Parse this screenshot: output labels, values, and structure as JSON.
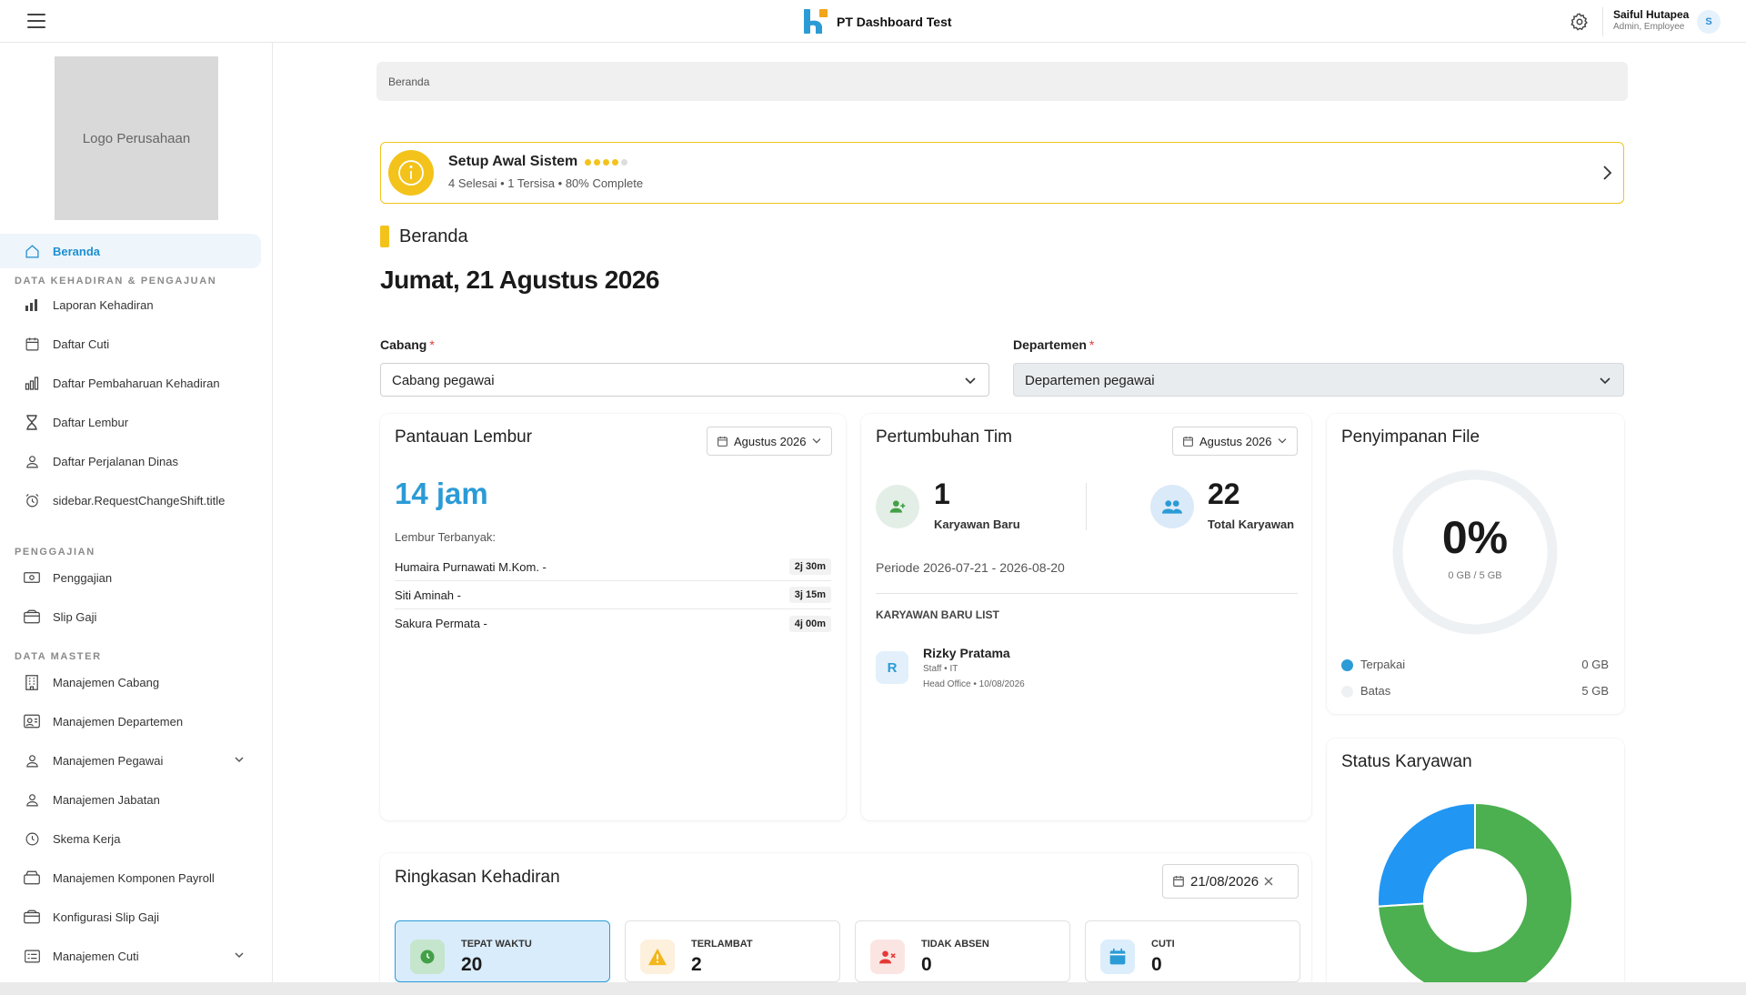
{
  "header": {
    "brand_title": "PT Dashboard Test",
    "user_name": "Saiful Hutapea",
    "user_role": "Admin, Employee",
    "avatar_initial": "S"
  },
  "sidebar": {
    "logo_text": "Logo Perusahaan",
    "home_label": "Beranda",
    "sections": [
      {
        "title": "DATA KEHADIRAN & PENGAJUAN",
        "items": [
          {
            "label": "Laporan Kehadiran",
            "icon": "bar-chart-icon"
          },
          {
            "label": "Daftar Cuti",
            "icon": "calendar-icon"
          },
          {
            "label": "Daftar Pembaharuan Kehadiran",
            "icon": "chart-icon"
          },
          {
            "label": "Daftar Lembur",
            "icon": "hourglass-icon"
          },
          {
            "label": "Daftar Perjalanan Dinas",
            "icon": "person-icon"
          },
          {
            "label": "sidebar.RequestChangeShift.title",
            "icon": "alarm-icon"
          }
        ]
      },
      {
        "title": "PENGGAJIAN",
        "items": [
          {
            "label": "Penggajian",
            "icon": "money-icon"
          },
          {
            "label": "Slip Gaji",
            "icon": "wallet-icon"
          }
        ]
      },
      {
        "title": "DATA MASTER",
        "items": [
          {
            "label": "Manajemen Cabang",
            "icon": "building-icon"
          },
          {
            "label": "Manajemen Departemen",
            "icon": "id-card-icon"
          },
          {
            "label": "Manajemen Pegawai",
            "icon": "person-icon"
          },
          {
            "label": "Manajemen Jabatan",
            "icon": "person-icon"
          },
          {
            "label": "Skema Kerja",
            "icon": "clock-icon"
          },
          {
            "label": "Manajemen Komponen Payroll",
            "icon": "box-icon"
          },
          {
            "label": "Konfigurasi Slip Gaji",
            "icon": "wallet-icon"
          },
          {
            "label": "Manajemen Cuti",
            "icon": "list-icon"
          }
        ]
      }
    ]
  },
  "main": {
    "breadcrumb": "Beranda",
    "setup": {
      "title": "Setup Awal Sistem",
      "subtitle": "4 Selesai • 1 Tersisa • 80% Complete",
      "progress": 0.8
    },
    "section_title": "Beranda",
    "date_title": "Jumat, 21 Agustus 2026",
    "filters": {
      "branch_label": "Cabang",
      "branch_value": "Cabang pegawai",
      "dept_label": "Departemen",
      "dept_value": "Departemen pegawai",
      "required_mark": "*"
    },
    "overtime": {
      "title": "Pantauan Lembur",
      "month": "Agustus 2026",
      "total": "14 jam",
      "top_label": "Lembur Terbanyak:",
      "rows": [
        {
          "name": "Humaira Purnawati M.Kom. -",
          "value": "2j 30m"
        },
        {
          "name": "Siti Aminah -",
          "value": "3j 15m"
        },
        {
          "name": "Sakura Permata -",
          "value": "4j 00m"
        }
      ]
    },
    "growth": {
      "title": "Pertumbuhan Tim",
      "month": "Agustus 2026",
      "new_count": "1",
      "new_label": "Karyawan Baru",
      "total_count": "22",
      "total_label": "Total Karyawan",
      "period": "Periode 2026-07-21 - 2026-08-20",
      "list_title": "KARYAWAN BARU LIST",
      "new_employees": [
        {
          "initial": "R",
          "name": "Rizky Pratama",
          "role": "Staff • IT",
          "meta": "Head Office • 10/08/2026"
        }
      ]
    },
    "storage": {
      "title": "Penyimpanan File",
      "percent": "0%",
      "usage": "0 GB / 5 GB",
      "legend": [
        {
          "label": "Terpakai",
          "value": "0 GB",
          "color": "#2b9bd6"
        },
        {
          "label": "Batas",
          "value": "5 GB",
          "color": "#eef1f3"
        }
      ]
    },
    "status": {
      "title": "Status Karyawan"
    },
    "attendance": {
      "title": "Ringkasan Kehadiran",
      "date": "21/08/2026",
      "cards": [
        {
          "label": "TEPAT WAKTU",
          "value": "20",
          "icon": "clock-icon"
        },
        {
          "label": "TERLAMBAT",
          "value": "2",
          "icon": "warning-icon"
        },
        {
          "label": "TIDAK ABSEN",
          "value": "0",
          "icon": "user-x-icon"
        },
        {
          "label": "CUTI",
          "value": "0",
          "icon": "calendar-icon"
        }
      ]
    }
  },
  "chart_data": {
    "type": "pie",
    "categories": [
      "Blue segment",
      "Green segment"
    ],
    "values": [
      26,
      74
    ],
    "colors": [
      "#2196f3",
      "#4caf50"
    ],
    "donut": true
  }
}
